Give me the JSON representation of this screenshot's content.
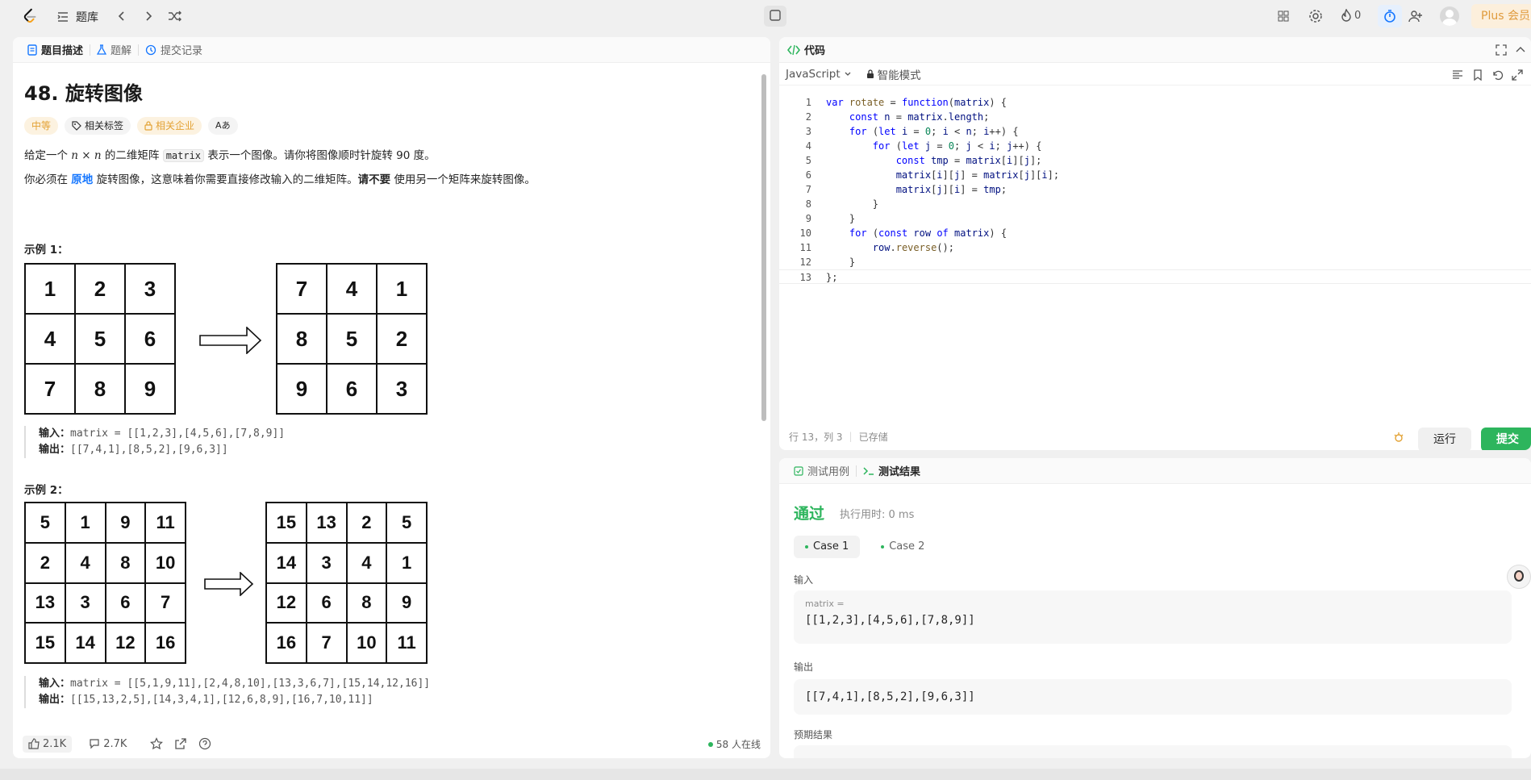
{
  "topbar": {
    "problem_list": "题库",
    "streak_count": "0",
    "plus_label": "Plus 会员"
  },
  "left_tabs": [
    "题目描述",
    "题解",
    "提交记录"
  ],
  "problem": {
    "title": "48. 旋转图像",
    "difficulty": "中等",
    "tags_label": "相关标签",
    "companies_label": "相关企业",
    "font_label": "Aあ",
    "desc1_pre": "给定一个 ",
    "desc1_var": "n × n",
    "desc1_mid": " 的二维矩阵 ",
    "desc1_code": "matrix",
    "desc1_post": " 表示一个图像。请你将图像顺时针旋转 90 度。",
    "desc2_pre": "你必须在 ",
    "desc2_highlight": "原地",
    "desc2_mid": " 旋转图像，这意味着你需要直接修改输入的二维矩阵。",
    "desc2_bold": "请不要",
    "desc2_post": " 使用另一个矩阵来旋转图像。",
    "example1": {
      "title": "示例 1：",
      "input_grid": [
        "1",
        "2",
        "3",
        "4",
        "5",
        "6",
        "7",
        "8",
        "9"
      ],
      "output_grid": [
        "7",
        "4",
        "1",
        "8",
        "5",
        "2",
        "9",
        "6",
        "3"
      ],
      "input_label": "输入：",
      "input_value": "matrix = [[1,2,3],[4,5,6],[7,8,9]]",
      "output_label": "输出：",
      "output_value": "[[7,4,1],[8,5,2],[9,6,3]]"
    },
    "example2": {
      "title": "示例 2：",
      "input_grid": [
        "5",
        "1",
        "9",
        "11",
        "2",
        "4",
        "8",
        "10",
        "13",
        "3",
        "6",
        "7",
        "15",
        "14",
        "12",
        "16"
      ],
      "output_grid": [
        "15",
        "13",
        "2",
        "5",
        "14",
        "3",
        "4",
        "1",
        "12",
        "6",
        "8",
        "9",
        "16",
        "7",
        "10",
        "11"
      ],
      "input_label": "输入：",
      "input_value": "matrix = [[5,1,9,11],[2,4,8,10],[13,3,6,7],[15,14,12,16]]",
      "output_label": "输出：",
      "output_value": "[[15,13,2,5],[14,3,4,1],[12,6,8,9],[16,7,10,11]]"
    }
  },
  "footer": {
    "likes": "2.1K",
    "comments": "2.7K",
    "online": "58 人在线"
  },
  "code_panel": {
    "title": "代码",
    "language": "JavaScript",
    "mode": "智能模式",
    "cursor_pos": "行 13，列 3",
    "saved": "已存储",
    "run_label": "运行",
    "submit_label": "提交",
    "lines": [
      "1",
      "2",
      "3",
      "4",
      "5",
      "6",
      "7",
      "8",
      "9",
      "10",
      "11",
      "12",
      "13"
    ]
  },
  "result_panel": {
    "tab_cases": "测试用例",
    "tab_results": "测试结果",
    "status": "通过",
    "runtime": "执行用时: 0 ms",
    "case1": "Case 1",
    "case2": "Case 2",
    "input_label": "输入",
    "var_label": "matrix =",
    "input_value": "[[1,2,3],[4,5,6],[7,8,9]]",
    "output_label": "输出",
    "output_value": "[[7,4,1],[8,5,2],[9,6,3]]",
    "expected_label": "预期结果"
  }
}
